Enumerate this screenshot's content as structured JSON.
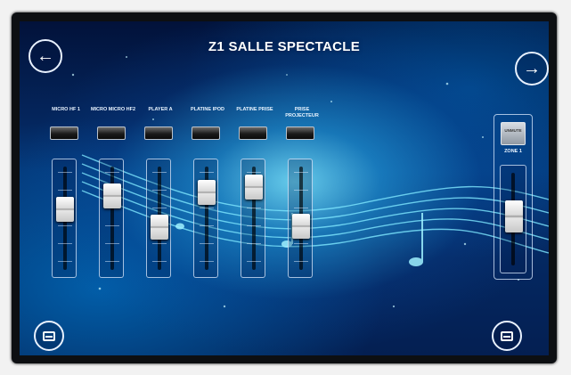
{
  "header": {
    "title": "Z1 SALLE SPECTACLE"
  },
  "nav": {
    "back_icon": "←",
    "next_icon": "→"
  },
  "channels": [
    {
      "label": "MICRO HF 1",
      "level": 0.62
    },
    {
      "label": "MICRO MICRO HF2",
      "level": 0.78
    },
    {
      "label": "PLAYER A",
      "level": 0.4
    },
    {
      "label": "PLATINE IPOD",
      "level": 0.82
    },
    {
      "label": "PLATINE PRISE",
      "level": 0.88
    },
    {
      "label": "PRISE PROJECTEUR",
      "level": 0.42
    }
  ],
  "master": {
    "mute_label": "UNMUTE",
    "label": "Zone 1",
    "level": 0.55
  },
  "footer": {
    "left_icon": "screen-icon",
    "right_icon": "screen-icon"
  },
  "colors": {
    "accent": "#36c6ff",
    "background": "#05306f"
  }
}
